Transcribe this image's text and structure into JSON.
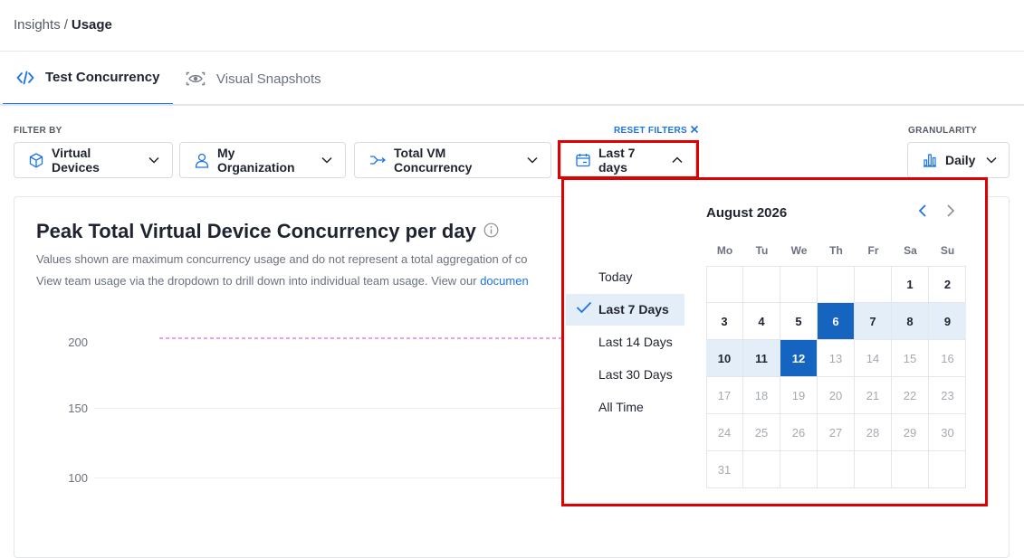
{
  "breadcrumb": {
    "parent": "Insights",
    "separator": "/",
    "current": "Usage"
  },
  "tabs": [
    {
      "label": "Test Concurrency",
      "icon": "code-icon",
      "active": true
    },
    {
      "label": "Visual Snapshots",
      "icon": "eye-icon",
      "active": false
    }
  ],
  "filters": {
    "filter_by_label": "FILTER BY",
    "reset_label": "RESET FILTERS",
    "granularity_label": "GRANULARITY",
    "device": "Virtual Devices",
    "organization": "My Organization",
    "concurrency": "Total VM Concurrency",
    "date": "Last 7 days",
    "granularity": "Daily"
  },
  "chart": {
    "title": "Peak Total Virtual Device Concurrency per day",
    "desc1": "Values shown are maximum concurrency usage and do not represent a total aggregation of co",
    "desc2_pre": "View team usage via the dropdown to drill down into individual team usage. View our ",
    "desc2_link": "documen",
    "y_ticks": [
      "200",
      "150",
      "100"
    ]
  },
  "chart_data": {
    "type": "line",
    "title": "Peak Total Virtual Device Concurrency per day",
    "y_ticks": [
      200,
      150,
      100
    ],
    "series": [
      {
        "name": "",
        "style": "dashed",
        "color": "#e040c0",
        "values": [
          200
        ]
      }
    ]
  },
  "date_picker": {
    "presets": [
      "Today",
      "Last 7 Days",
      "Last 14 Days",
      "Last 30 Days",
      "All Time"
    ],
    "selected_preset": "Last 7 Days",
    "month_label": "August 2026",
    "weekdays": [
      "Mo",
      "Tu",
      "We",
      "Th",
      "Fr",
      "Sa",
      "Su"
    ],
    "days": [
      [
        "",
        "",
        "",
        "",
        "",
        "1",
        "2"
      ],
      [
        "3",
        "4",
        "5",
        "6",
        "7",
        "8",
        "9"
      ],
      [
        "10",
        "11",
        "12",
        "13",
        "14",
        "15",
        "16"
      ],
      [
        "17",
        "18",
        "19",
        "20",
        "21",
        "22",
        "23"
      ],
      [
        "24",
        "25",
        "26",
        "27",
        "28",
        "29",
        "30"
      ],
      [
        "31",
        "",
        "",
        "",
        "",
        "",
        ""
      ]
    ],
    "range_start": 6,
    "range_end": 12,
    "last_enabled_day": 12
  },
  "colors": {
    "accent": "#1a73e8",
    "highlight": "#e00000",
    "range": "#e4eef9",
    "selected": "#1565c0"
  }
}
